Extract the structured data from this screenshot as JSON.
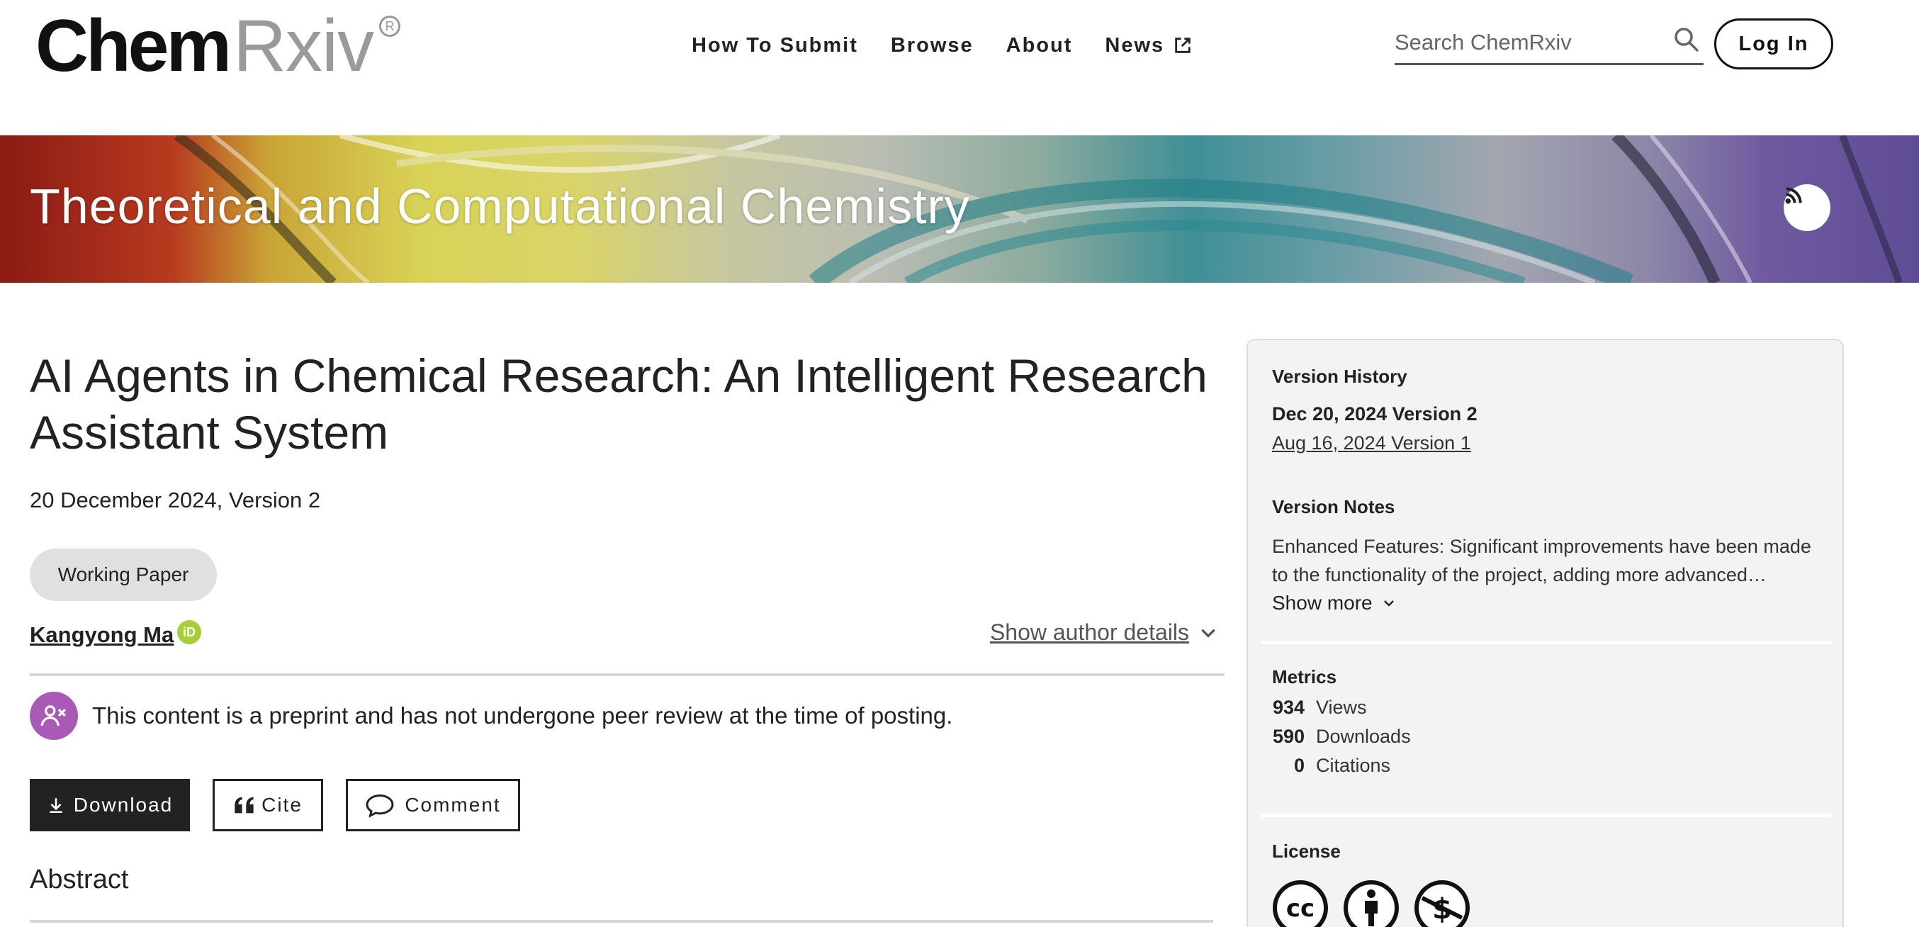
{
  "header": {
    "logo_primary": "Chem",
    "logo_secondary": "Rxiv",
    "logo_registered": "R",
    "nav": [
      {
        "label": "How To Submit"
      },
      {
        "label": "Browse"
      },
      {
        "label": "About"
      },
      {
        "label": "News",
        "icon": "external-link-icon"
      }
    ],
    "search_placeholder": "Search ChemRxiv",
    "login_label": "Log In"
  },
  "banner": {
    "category": "Theoretical and Computational Chemistry",
    "rss_icon": "rss-icon"
  },
  "article": {
    "title": "AI Agents in Chemical Research: An Intelligent Research Assistant System",
    "date": "20 December 2024, Version 2",
    "type": "Working Paper",
    "author": "Kangyong Ma",
    "orcid_label": "iD",
    "show_author_details": "Show author details",
    "peer_review_notice": "This content is a preprint and has not undergone peer review at the time of posting.",
    "actions": {
      "download": "Download",
      "cite": "Cite",
      "comment": "Comment"
    },
    "abstract_heading": "Abstract"
  },
  "sidebar": {
    "version_history": {
      "heading": "Version History",
      "current": "Dec 20, 2024 Version 2",
      "previous": "Aug 16, 2024 Version 1"
    },
    "version_notes": {
      "heading": "Version Notes",
      "text": "Enhanced Features: Significant improvements have been made to the functionality of the project, adding more advanced…",
      "show_more": "Show more"
    },
    "metrics": {
      "heading": "Metrics",
      "items": [
        {
          "value": "934",
          "label": "Views"
        },
        {
          "value": "590",
          "label": "Downloads"
        },
        {
          "value": "0",
          "label": "Citations"
        }
      ]
    },
    "license": {
      "heading": "License",
      "icons": [
        "cc-icon",
        "attribution-icon",
        "noncommercial-icon"
      ]
    }
  },
  "colors": {
    "brand_dark": "#222222",
    "logo_gray": "#9a9a9a",
    "peer_icon_bg": "#a95ab7",
    "orcid_green": "#a6ce39",
    "sidebar_bg": "#f3f3f3"
  }
}
